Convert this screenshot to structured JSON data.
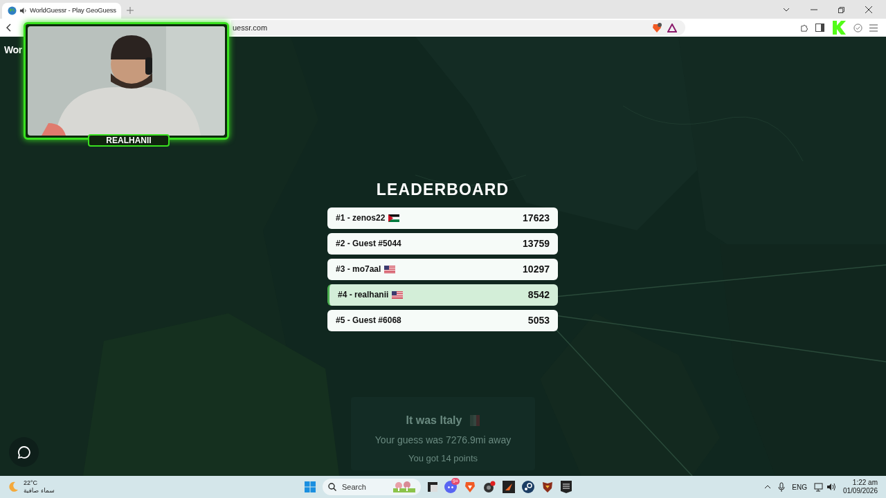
{
  "browser": {
    "tab": {
      "title": "WorldGuessr - Play GeoGuess",
      "audio_playing": true
    },
    "address": "uessr.com"
  },
  "webcam": {
    "label": "REALHANII"
  },
  "page": {
    "logo_text": "Wor",
    "leaderboard": {
      "title": "LEADERBOARD",
      "rows": [
        {
          "player": "#1 - zenos22",
          "kind": "tricolor",
          "score": "17623",
          "selected": false
        },
        {
          "player": "#2 - Guest #5044",
          "kind": "plain",
          "score": "13759",
          "selected": false
        },
        {
          "player": "#3 - mo7aal",
          "kind": "striped",
          "score": "10297",
          "selected": false
        },
        {
          "player": "#4 - realhanii",
          "kind": "striped",
          "score": "8542",
          "selected": true
        },
        {
          "player": "#5 - Guest #6068",
          "kind": "plain",
          "score": "5053",
          "selected": false
        }
      ]
    },
    "result": {
      "headline": "It was Italy",
      "distance": "Your guess was 7276.9mi away",
      "points": "You got 14 points"
    }
  },
  "taskbar": {
    "weather": {
      "temperature": "22°C",
      "condition": "سماء صافية"
    },
    "search": {
      "placeholder": "Search"
    },
    "chat_badge": "9+",
    "language": "ENG",
    "time": "1:22 am",
    "date": "01/09/2026"
  }
}
